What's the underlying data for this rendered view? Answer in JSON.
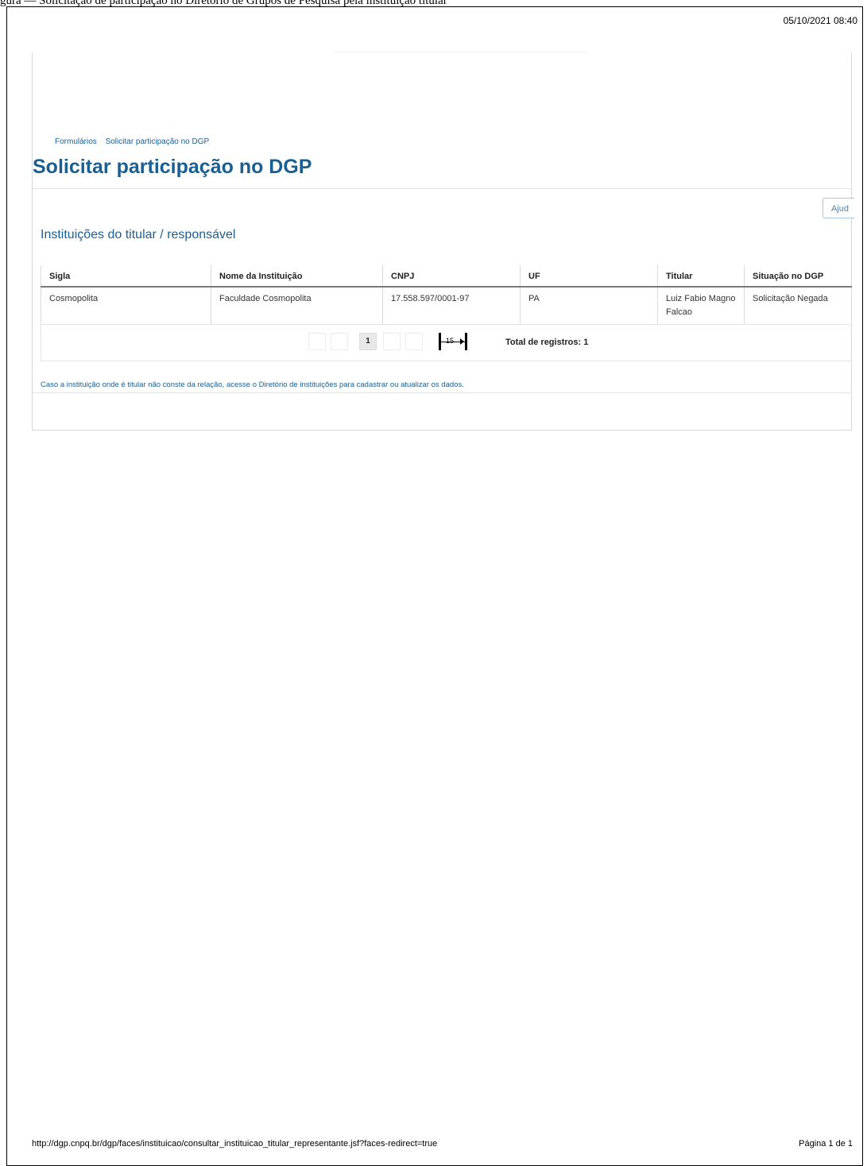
{
  "caption": "gura — Solicitação de participação no Diretório de Grupos de Pesquisa pela instituição titular",
  "timestamp": "05/10/2021 08:40",
  "breadcrumb": [
    "Formulários",
    "Solicitar participação no DGP"
  ],
  "page_title": "Solicitar participação no DGP",
  "help_button": "Ajud",
  "section_title": "Instituições do titular / responsável",
  "table": {
    "columns": [
      "Sigla",
      "Nome da Instituição",
      "CNPJ",
      "UF",
      "Titular",
      "Situação no DGP"
    ],
    "rows": [
      [
        "Cosmopolita",
        "Faculdade Cosmopolita",
        "17.558.597/0001-97",
        "PA",
        "Luiz Fabio Magno Falcao",
        "Solicitação Negada"
      ]
    ]
  },
  "pagination": {
    "current_page": "1",
    "rows_per_page": "15",
    "total": "Total de registros: 1"
  },
  "note": "Caso a instituição onde é titular não conste da relação, acesse o Diretório de instituições para cadastrar ou atualizar os dados.",
  "footer": {
    "url": "http://dgp.cnpq.br/dgp/faces/instituicao/consultar_instituicao_titular_representante.jsf?faces-redirect=true",
    "page": "Página 1 de 1"
  }
}
